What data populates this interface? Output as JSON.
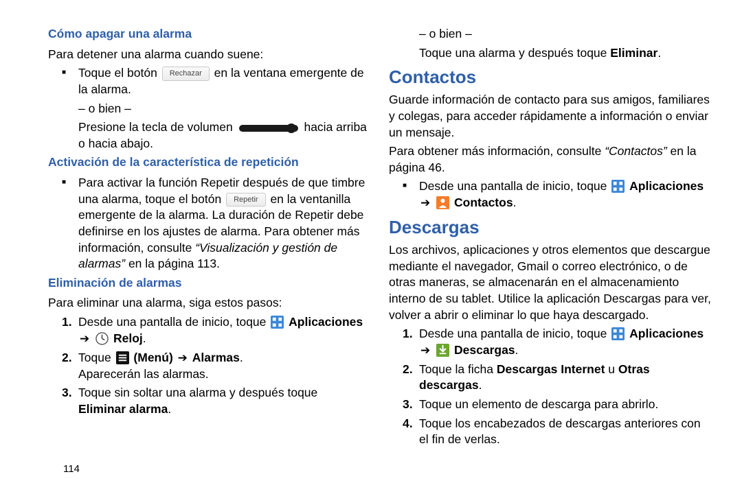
{
  "page_number": "114",
  "left": {
    "h_off": "Cómo apagar una alarma",
    "p_off_intro": "Para detener una alarma cuando suene:",
    "b_off_pre": "Toque el botón",
    "btn_reject": "Rechazar",
    "b_off_post": "en la ventana emergente de la alarma.",
    "or": "– o bien –",
    "b_off2_pre": "Presione la tecla de volumen",
    "b_off2_post": "hacia arriba o hacia abajo.",
    "h_snooze": "Activación de la característica de repetición",
    "b_snz_pre": "Para activar la función Repetir después de que timbre una alarma, toque el botón",
    "btn_repeat": "Repetir",
    "b_snz_post1": "en la ventanilla emergente de la alarma. La duración de Repetir debe definirse en los ajustes de alarma. Para obtener más información, consulte ",
    "b_snz_ref": "“Visualización y gestión de alarmas”",
    "b_snz_post2": " en la página 113.",
    "h_del": "Eliminación de alarmas",
    "p_del_intro": "Para eliminar una alarma, siga estos pasos:",
    "ol1_pre": "Desde una pantalla de inicio, toque ",
    "apps_label": "Aplicaciones",
    "reloj_label": "Reloj",
    "ol2_pre": "Toque ",
    "menu_label": "(Menú)",
    "alarmas_label": "Alarmas",
    "ol2_post": "Aparecerán las alarmas.",
    "ol3_pre": "Toque sin soltar una alarma y después toque ",
    "ol3_bold": "Eliminar alarma",
    "period": "."
  },
  "right": {
    "or": "– o bien –",
    "p_elim_alt_pre": "Toque una alarma y después toque ",
    "p_elim_alt_bold": "Eliminar",
    "h_contacts": "Contactos",
    "p_contacts_1": "Guarde información de contacto para sus amigos, familiares y colegas, para acceder rápidamente a información o enviar un mensaje.",
    "p_contacts_2_pre": "Para obtener más información, consulte ",
    "p_contacts_2_ref": "“Contactos”",
    "p_contacts_2_post": " en la página 46.",
    "b_c_pre": "Desde una pantalla de inicio, toque ",
    "apps_label": "Aplicaciones",
    "contactos_label": "Contactos",
    "h_downloads": "Descargas",
    "p_dl_body": "Los archivos, aplicaciones y otros elementos que descargue mediante el navegador, Gmail o correo electrónico, o de otras maneras, se almacenarán en el almacenamiento interno de su tablet. Utilice la aplicación Descargas para ver, volver a abrir o eliminar lo que haya descargado.",
    "ol1_pre": "Desde una pantalla de inicio, toque ",
    "descargas_label": "Descargas",
    "ol2_pre": "Toque la ficha ",
    "ol2_b1": "Descargas Internet",
    "ol2_mid": " u ",
    "ol2_b2": "Otras descargas",
    "ol3": "Toque un elemento de descarga para abrirlo.",
    "ol4": "Toque los encabezados de descargas anteriores con el fin de verlas.",
    "period": "."
  }
}
